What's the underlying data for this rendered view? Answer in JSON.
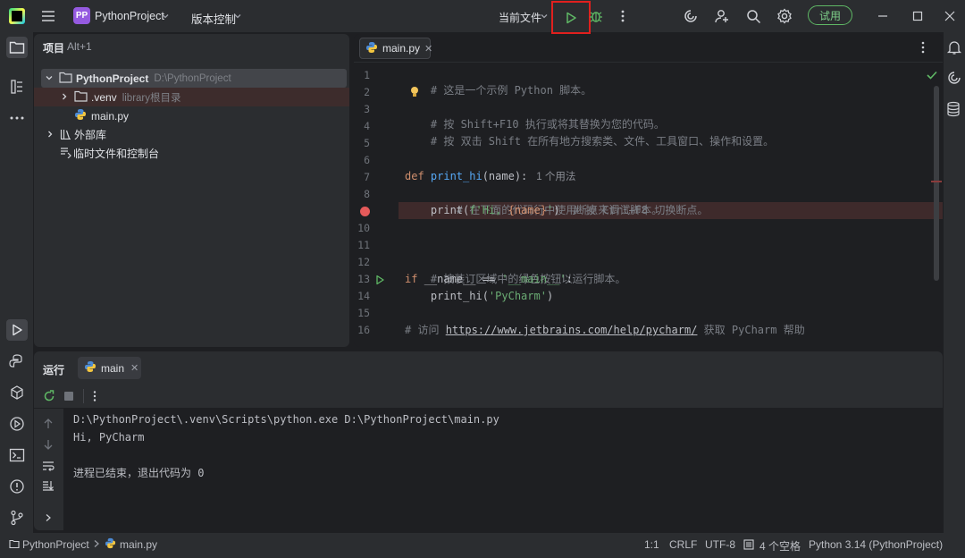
{
  "titlebar": {
    "project_initials": "PP",
    "project_name": "PythonProject",
    "vcs_label": "版本控制",
    "run_config": "当前文件",
    "trial_label": "试用"
  },
  "project_panel": {
    "title": "项目",
    "shortcut": "Alt+1",
    "tree": [
      {
        "label": "PythonProject",
        "sub": "D:\\PythonProject"
      },
      {
        "label": ".venv",
        "sub": "library根目录"
      },
      {
        "label": "main.py",
        "sub": ""
      },
      {
        "label": "外部库",
        "sub": ""
      },
      {
        "label": "临时文件和控制台",
        "sub": ""
      }
    ]
  },
  "editor": {
    "tab_name": "main.py",
    "line_numbers": [
      "1",
      "2",
      "3",
      "4",
      "5",
      "6",
      "7",
      "8",
      "9",
      "10",
      "11",
      "12",
      "13",
      "14",
      "15",
      "16"
    ],
    "lines": {
      "l1": "# 这是一个示例 Python 脚本。",
      "l3": "# 按 Shift+F10 执行或将其替换为您的代码。",
      "l4": "# 按 双击 Shift 在所有地方搜索类、文件、工具窗口、操作和设置。",
      "l7_kw": "def ",
      "l7_fn": "print_hi",
      "l7_rest": "(name):",
      "l7_hint": "1 个用法",
      "l8": "    # 在下面的代码行中使用断点来调试脚本。",
      "l9_a": "    print(",
      "l9_str1": "f'Hi, ",
      "l9_brace": "{name}",
      "l9_str2": "'",
      "l9_b": ")  ",
      "l9_comment": "# 按 Ctrl+F8 切换断点。",
      "l12": "# 按装订区域中的绿色按钮以运行脚本。",
      "l13_kw": "if ",
      "l13_a": "__name__ == ",
      "l13_str": "'__main__'",
      "l13_b": ":",
      "l14_a": "    print_hi(",
      "l14_str": "'PyCharm'",
      "l14_b": ")",
      "l16_a": "# 访问 ",
      "l16_link": "https://www.jetbrains.com/help/pycharm/",
      "l16_b": " 获取 PyCharm 帮助"
    }
  },
  "run_panel": {
    "title": "运行",
    "tab_name": "main",
    "output": [
      "D:\\PythonProject\\.venv\\Scripts\\python.exe D:\\PythonProject\\main.py",
      "Hi, PyCharm",
      "",
      "进程已结束，退出代码为 0"
    ]
  },
  "statusbar": {
    "breadcrumb_project": "PythonProject",
    "breadcrumb_file": "main.py",
    "position": "1:1",
    "line_sep": "CRLF",
    "encoding": "UTF-8",
    "indent": "4 个空格",
    "interpreter": "Python 3.14 (PythonProject)"
  },
  "colors": {
    "accent_green": "#5fb865",
    "run_highlight": "#e0201e",
    "breakpoint": "#e55a5a"
  }
}
